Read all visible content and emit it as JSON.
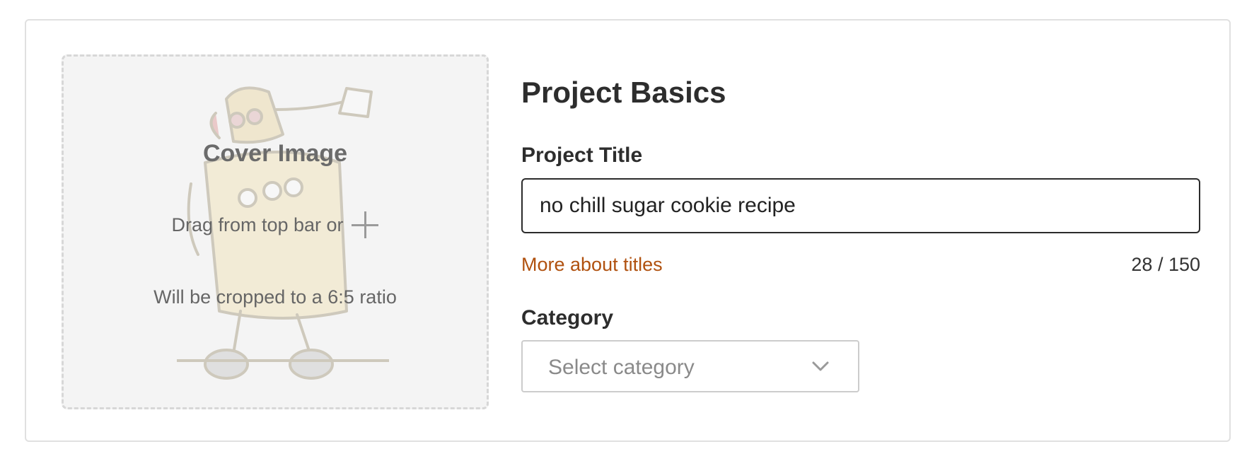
{
  "cover": {
    "title": "Cover Image",
    "drag_text": "Drag from top bar or",
    "add_icon": "plus-icon",
    "ratio_note": "Will be cropped to a 6:5 ratio",
    "placeholder_illustration": "robot-mascot"
  },
  "basics": {
    "section_title": "Project Basics",
    "title_field": {
      "label": "Project Title",
      "value": "no chill sugar cookie recipe",
      "help_link": "More about titles",
      "char_count": "28 / 150"
    },
    "category_field": {
      "label": "Category",
      "placeholder": "Select category",
      "icon": "chevron-down-icon"
    }
  },
  "colors": {
    "link": "#b0510f",
    "input_border": "#2b2b2b",
    "dropzone_bg": "#f4f4f4"
  }
}
